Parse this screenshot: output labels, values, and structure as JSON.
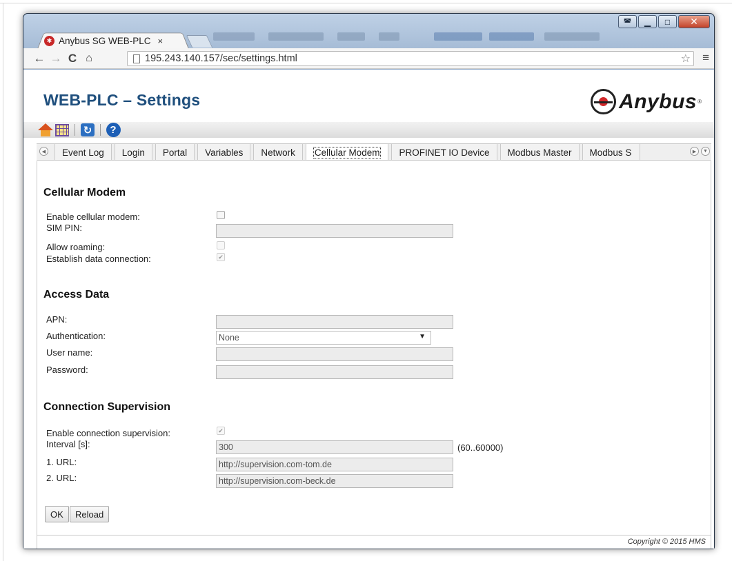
{
  "browser": {
    "tab_title": "Anybus SG WEB-PLC",
    "tab_close": "×",
    "url": "195.243.140.157/sec/settings.html"
  },
  "page": {
    "title": "WEB-PLC – Settings",
    "logo_text": "Anybus",
    "logo_reg": "®",
    "copyright": "Copyright © 2015 HMS"
  },
  "tabs": [
    "Event Log",
    "Login",
    "Portal",
    "Variables",
    "Network",
    "Cellular Modem",
    "PROFINET IO Device",
    "Modbus Master",
    "Modbus S"
  ],
  "active_tab": "Cellular Modem",
  "cellular": {
    "heading": "Cellular Modem",
    "enable_label": "Enable cellular modem:",
    "enable_checked": false,
    "sim_pin_label": "SIM PIN:",
    "sim_pin_value": "",
    "roaming_label": "Allow roaming:",
    "roaming_checked": false,
    "data_conn_label": "Establish data connection:",
    "data_conn_checked": true
  },
  "access": {
    "heading": "Access Data",
    "apn_label": "APN:",
    "apn_value": "",
    "auth_label": "Authentication:",
    "auth_value": "None",
    "user_label": "User name:",
    "user_value": "",
    "password_label": "Password:",
    "password_value": ""
  },
  "supervision": {
    "heading": "Connection Supervision",
    "enable_label": "Enable connection supervision:",
    "enable_checked": true,
    "interval_label": "Interval [s]:",
    "interval_value": "300",
    "interval_range": "(60..60000)",
    "url1_label": "1. URL:",
    "url1_value": "http://supervision.com-tom.de",
    "url2_label": "2. URL:",
    "url2_value": "http://supervision.com-beck.de"
  },
  "buttons": {
    "ok": "OK",
    "reload": "Reload"
  },
  "colors": {
    "title": "#1f4f7d",
    "logo_red": "#d2282a"
  }
}
